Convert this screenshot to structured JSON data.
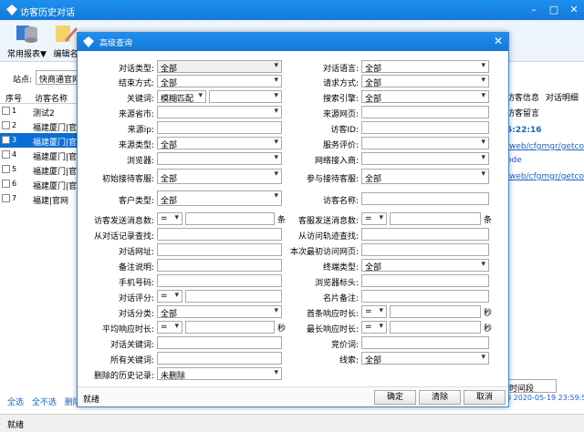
{
  "window": {
    "title": "访客历史对话"
  },
  "toolbar": {
    "common_report_label": "常用报表▼",
    "edit_label": "编辑名"
  },
  "site": {
    "label": "站点:",
    "value": "快商通官网"
  },
  "grid": {
    "col_num": "序号",
    "col_name": "访客名称",
    "rows": [
      {
        "num": "1",
        "name": "测试2",
        "selected": false
      },
      {
        "num": "2",
        "name": "福建厦门|官网",
        "selected": false
      },
      {
        "num": "3",
        "name": "福建厦门|官网",
        "selected": true
      },
      {
        "num": "4",
        "name": "福建厦门|官网",
        "selected": false
      },
      {
        "num": "5",
        "name": "福建厦门|官网",
        "selected": false
      },
      {
        "num": "6",
        "name": "福建厦门|官网",
        "selected": false
      },
      {
        "num": "7",
        "name": "福建|官网",
        "selected": false
      }
    ]
  },
  "bottom_links": {
    "select_all": "全选",
    "select_none": "全不选",
    "delete": "删除"
  },
  "statusbar": {
    "text": "就绪"
  },
  "right_panel": {
    "tab_visitor": "访客信息",
    "tab_dialog": "对话明细",
    "tab_message": "访客留言",
    "time": "5:22:16",
    "link1": "/web/cfgmgr/getcod",
    "link2": "ode",
    "link3": "/web/cfgmgr/getco",
    "combo": "时间段",
    "date": "0 2020-05-19 23:59:59"
  },
  "dialog": {
    "title": "高级查询",
    "status": "就绪",
    "ok": "确定",
    "clear": "清除",
    "cancel": "取消",
    "labels": {
      "dialog_type": "对话类型:",
      "dialog_lang": "对话语言:",
      "end_method": "结束方式:",
      "request_method": "请求方式:",
      "keyword": "关键词:",
      "search_engine": "搜索引擎:",
      "source_city": "来源省市:",
      "source_page": "来源网页:",
      "source_ip": "来源ip:",
      "visitor_id": "访客ID:",
      "source_type": "来源类型:",
      "service_eval": "服务评价:",
      "browser": "浏览器:",
      "network": "网络接入商:",
      "first_reception": "初始接待客服:",
      "participant": "参与接待客服:",
      "customer_type": "客户类型:",
      "visitor_name": "访客名称:",
      "visitor_msgs": "访客发送消息数:",
      "agent_msgs": "客服发送消息数:",
      "from_record": "从对话记录查找:",
      "from_track": "从访问轨迹查找:",
      "dialog_url": "对话网址:",
      "first_visit_page": "本次最初访问网页:",
      "note": "备注说明:",
      "terminal": "终端类型:",
      "phone": "手机号码:",
      "browser_mark": "浏览器标头:",
      "rating": "对话评分:",
      "card_note": "名片备注:",
      "category": "对话分类:",
      "first_resp": "首条响应时长:",
      "avg_resp": "平均响应时长:",
      "max_resp": "最长响应时长:",
      "dialog_kw": "对话关键词:",
      "bid_word": "竞价词:",
      "all_kw": "所有关键词:",
      "clue": "线索:",
      "deleted_history": "删除的历史记录:"
    },
    "values": {
      "all": "全部",
      "fuzzy": "模糊匹配",
      "op_eq": "=",
      "not_deleted": "未删除"
    },
    "units": {
      "count": "条",
      "second": "秒"
    }
  }
}
